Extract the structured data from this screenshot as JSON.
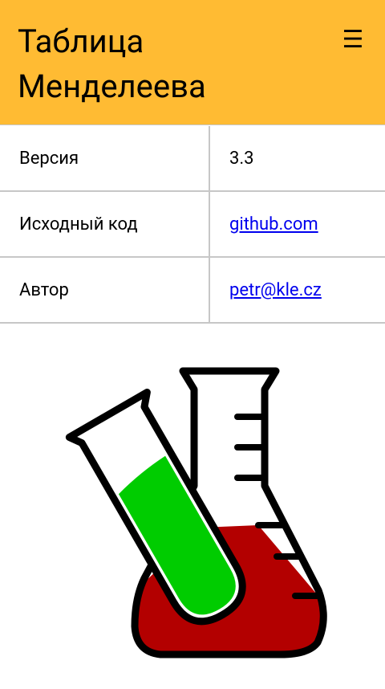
{
  "header": {
    "title": "Таблица Менделеева",
    "menu_icon": "☰"
  },
  "info_rows": [
    {
      "label": "Версия",
      "value": "3.3",
      "is_link": false
    },
    {
      "label": "Исходный код",
      "value": "github.com",
      "is_link": true
    },
    {
      "label": "Автор",
      "value": "petr@kle.cz",
      "is_link": true
    }
  ],
  "colors": {
    "header_bg": "#ffbb33",
    "link": "#0000ee",
    "liquid_green": "#00cc00",
    "liquid_red": "#b30000"
  },
  "illustration": {
    "icon": "chemistry-flask-test-tube-icon"
  }
}
